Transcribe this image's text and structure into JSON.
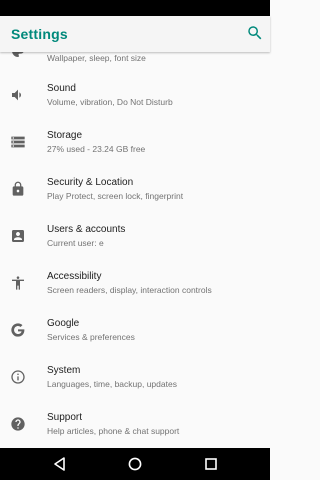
{
  "app_bar": {
    "title": "Settings"
  },
  "items": [
    {
      "icon": "wallpaper-icon",
      "title": "",
      "subtitle": "Wallpaper, sleep, font size"
    },
    {
      "icon": "volume-icon",
      "title": "Sound",
      "subtitle": "Volume, vibration, Do Not Disturb"
    },
    {
      "icon": "storage-icon",
      "title": "Storage",
      "subtitle": "27% used - 23.24 GB free"
    },
    {
      "icon": "lock-icon",
      "title": "Security & Location",
      "subtitle": "Play Protect, screen lock, fingerprint"
    },
    {
      "icon": "account-box-icon",
      "title": "Users & accounts",
      "subtitle": "Current user: e"
    },
    {
      "icon": "accessibility-icon",
      "title": "Accessibility",
      "subtitle": "Screen readers, display, interaction controls"
    },
    {
      "icon": "google-icon",
      "title": "Google",
      "subtitle": "Services & preferences"
    },
    {
      "icon": "info-icon",
      "title": "System",
      "subtitle": "Languages, time, backup, updates"
    },
    {
      "icon": "help-icon",
      "title": "Support",
      "subtitle": "Help articles, phone & chat support"
    }
  ],
  "colors": {
    "accent": "#00897b",
    "icon": "#616161"
  }
}
